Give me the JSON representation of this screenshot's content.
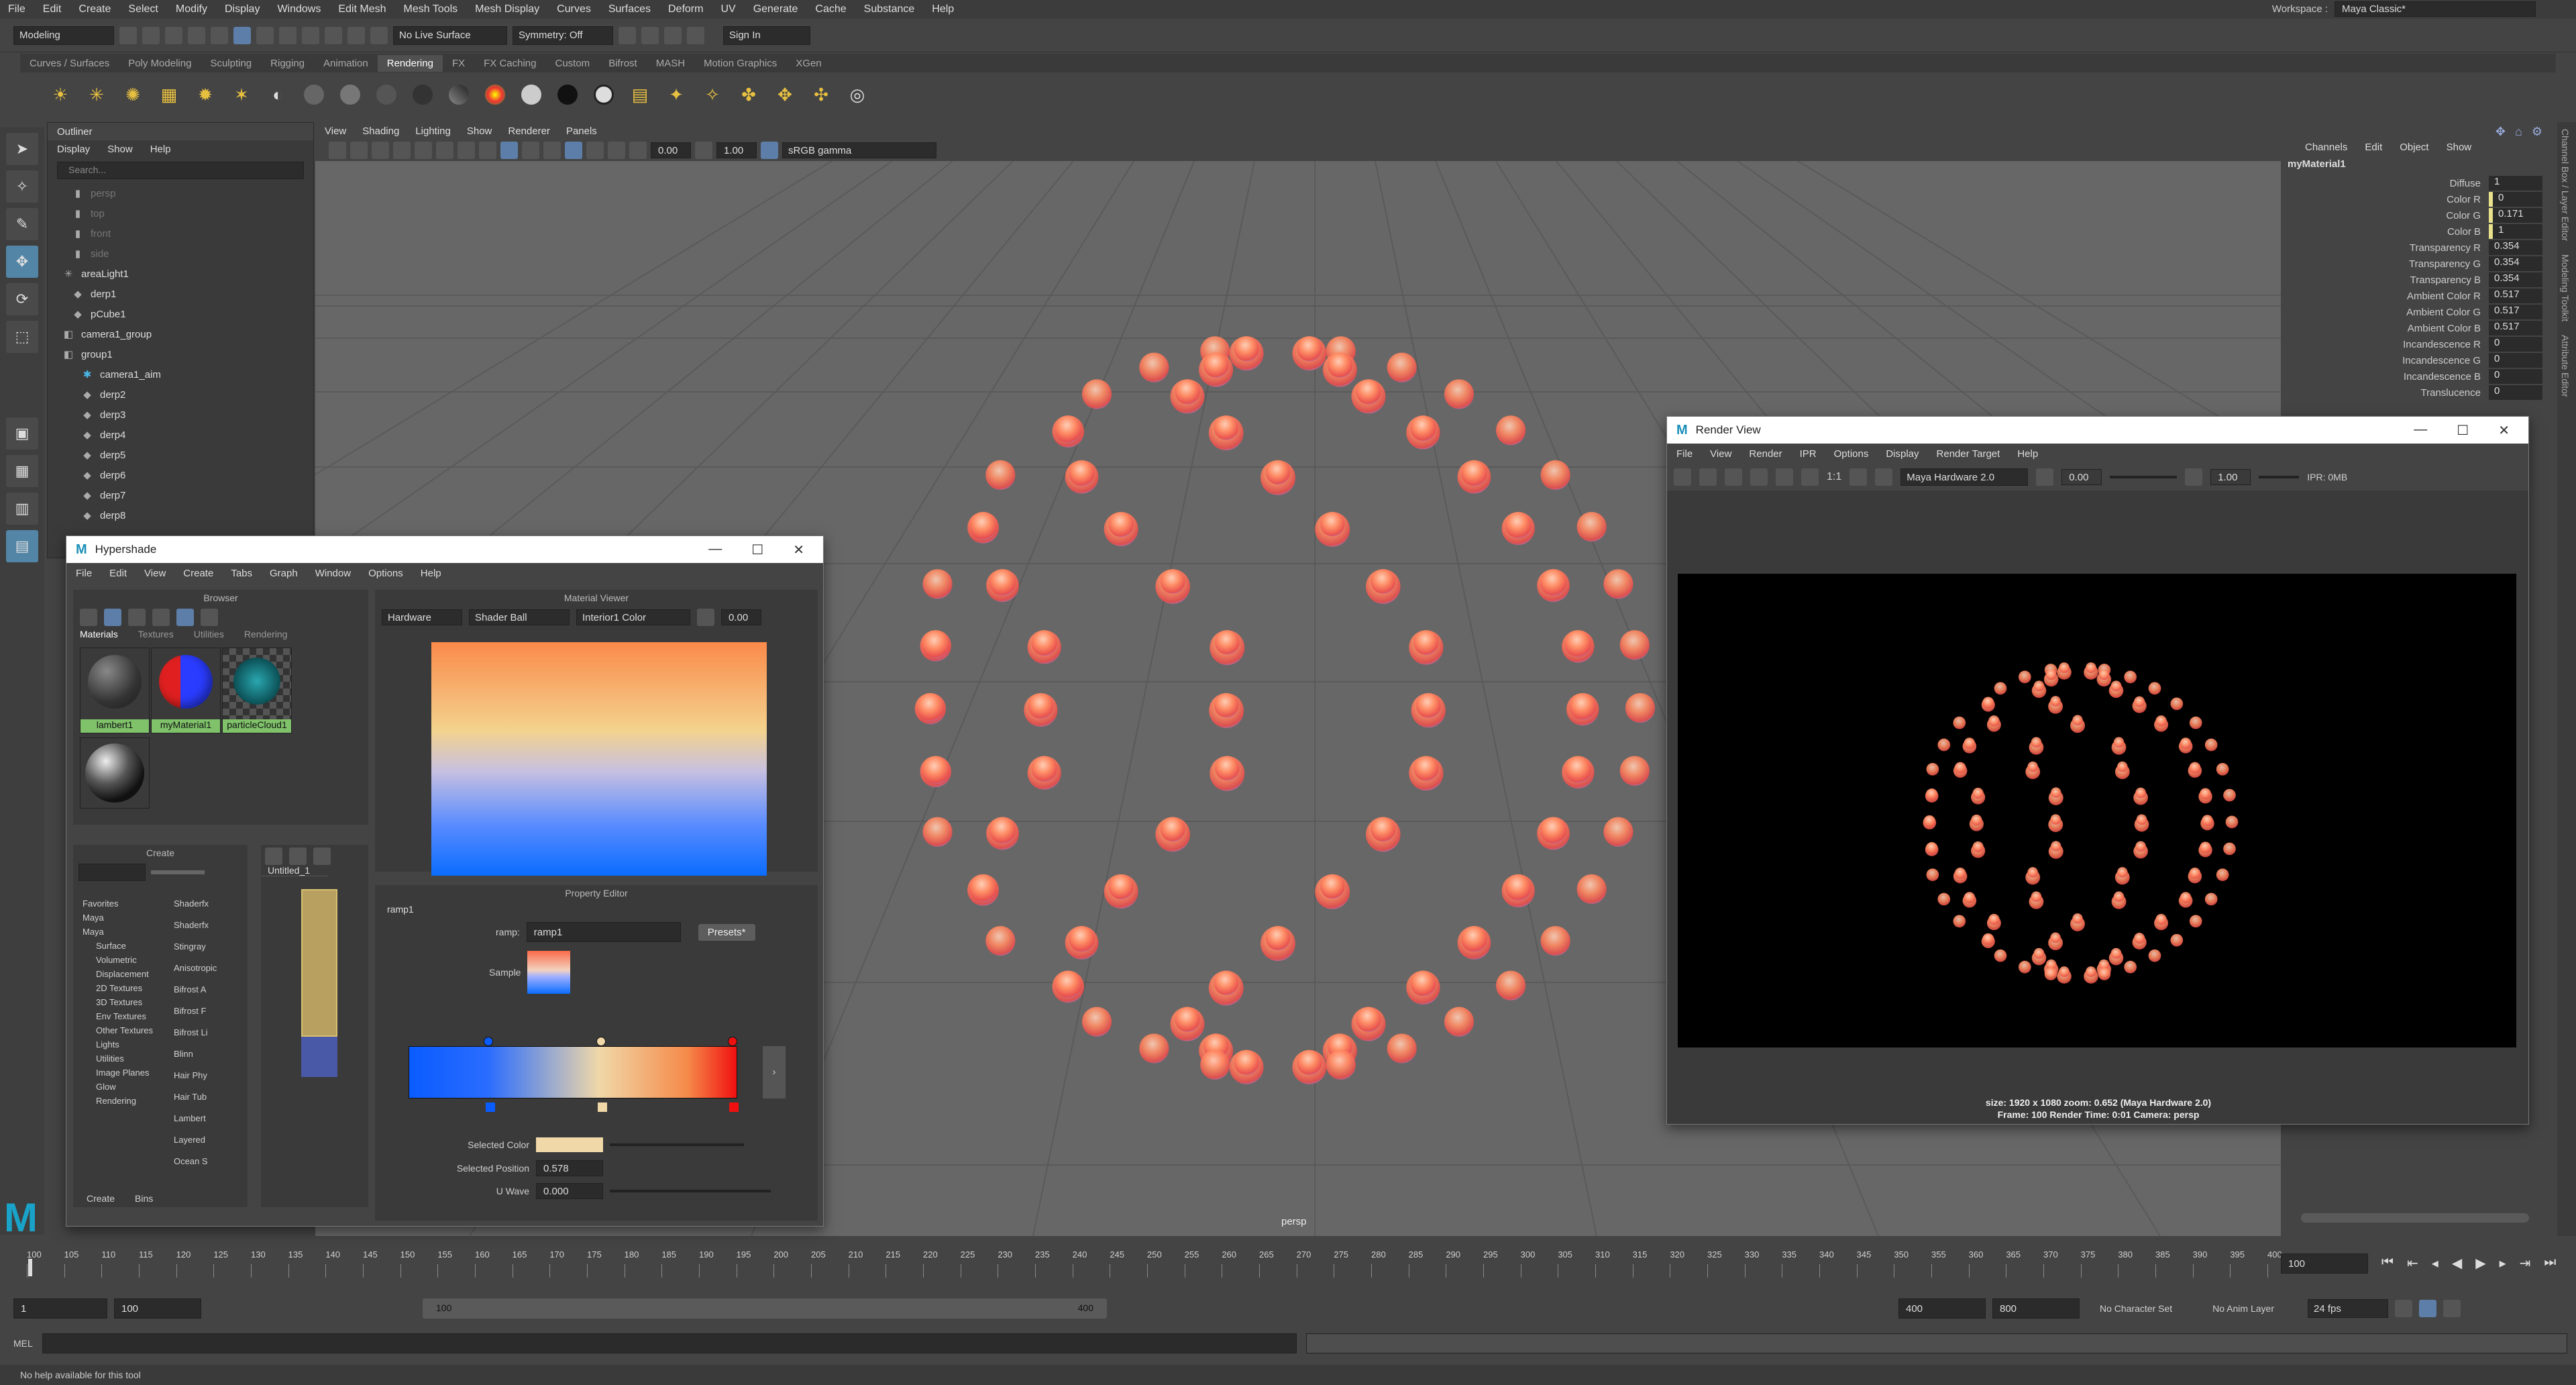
{
  "menubar": {
    "items": [
      "File",
      "Edit",
      "Create",
      "Select",
      "Modify",
      "Display",
      "Windows",
      "Edit Mesh",
      "Mesh Tools",
      "Mesh Display",
      "Curves",
      "Surfaces",
      "Deform",
      "UV",
      "Generate",
      "Cache",
      "Substance",
      "Help"
    ]
  },
  "workspace": {
    "label": "Workspace :",
    "value": "Maya Classic*"
  },
  "status": {
    "mode": "Modeling",
    "live_surface": "No Live Surface",
    "symmetry": "Symmetry: Off",
    "signin": "Sign In"
  },
  "shelf_tabs": [
    "Curves / Surfaces",
    "Poly Modeling",
    "Sculpting",
    "Rigging",
    "Animation",
    "Rendering",
    "FX",
    "FX Caching",
    "Custom",
    "Bifrost",
    "MASH",
    "Motion Graphics",
    "XGen"
  ],
  "shelf_active": "Rendering",
  "outliner": {
    "title": "Outliner",
    "menu": [
      "Display",
      "Show",
      "Help"
    ],
    "search_placeholder": "Search...",
    "items": [
      {
        "label": "persp",
        "dim": true,
        "indent": 1,
        "icon": "camera-icon"
      },
      {
        "label": "top",
        "dim": true,
        "indent": 1,
        "icon": "camera-icon"
      },
      {
        "label": "front",
        "dim": true,
        "indent": 1,
        "icon": "camera-icon"
      },
      {
        "label": "side",
        "dim": true,
        "indent": 1,
        "icon": "camera-icon"
      },
      {
        "label": "areaLight1",
        "dim": false,
        "indent": 0,
        "icon": "light-icon"
      },
      {
        "label": "derp1",
        "dim": false,
        "indent": 1,
        "icon": "mesh-icon"
      },
      {
        "label": "pCube1",
        "dim": false,
        "indent": 1,
        "icon": "mesh-icon"
      },
      {
        "label": "camera1_group",
        "dim": false,
        "indent": 0,
        "icon": "group-icon"
      },
      {
        "label": "group1",
        "dim": false,
        "indent": 0,
        "icon": "group-icon"
      },
      {
        "label": "camera1_aim",
        "dim": false,
        "indent": 2,
        "icon": "aim-icon"
      },
      {
        "label": "derp2",
        "dim": false,
        "indent": 2,
        "icon": "mesh-icon"
      },
      {
        "label": "derp3",
        "dim": false,
        "indent": 2,
        "icon": "mesh-icon"
      },
      {
        "label": "derp4",
        "dim": false,
        "indent": 2,
        "icon": "mesh-icon"
      },
      {
        "label": "derp5",
        "dim": false,
        "indent": 2,
        "icon": "mesh-icon"
      },
      {
        "label": "derp6",
        "dim": false,
        "indent": 2,
        "icon": "mesh-icon"
      },
      {
        "label": "derp7",
        "dim": false,
        "indent": 2,
        "icon": "mesh-icon"
      },
      {
        "label": "derp8",
        "dim": false,
        "indent": 2,
        "icon": "mesh-icon"
      }
    ]
  },
  "viewport": {
    "menu": [
      "View",
      "Shading",
      "Lighting",
      "Show",
      "Renderer",
      "Panels"
    ],
    "field1": "0.00",
    "field2": "1.00",
    "colorspace": "sRGB gamma",
    "camera_label": "persp"
  },
  "channelbox": {
    "menu": [
      "Channels",
      "Edit",
      "Object",
      "Show"
    ],
    "object": "myMaterial1",
    "rows": [
      {
        "label": "Diffuse",
        "value": "1",
        "swatch": false
      },
      {
        "label": "Color R",
        "value": "0",
        "swatch": true
      },
      {
        "label": "Color G",
        "value": "0.171",
        "swatch": true
      },
      {
        "label": "Color B",
        "value": "1",
        "swatch": true
      },
      {
        "label": "Transparency R",
        "value": "0.354",
        "swatch": false
      },
      {
        "label": "Transparency G",
        "value": "0.354",
        "swatch": false
      },
      {
        "label": "Transparency B",
        "value": "0.354",
        "swatch": false
      },
      {
        "label": "Ambient Color R",
        "value": "0.517",
        "swatch": false
      },
      {
        "label": "Ambient Color G",
        "value": "0.517",
        "swatch": false
      },
      {
        "label": "Ambient Color B",
        "value": "0.517",
        "swatch": false
      },
      {
        "label": "Incandescence R",
        "value": "0",
        "swatch": false
      },
      {
        "label": "Incandescence G",
        "value": "0",
        "swatch": false
      },
      {
        "label": "Incandescence B",
        "value": "0",
        "swatch": false
      },
      {
        "label": "Translucence",
        "value": "0",
        "swatch": false
      }
    ],
    "side_tabs": [
      "Channel Box / Layer Editor",
      "Modeling Toolkit",
      "Attribute Editor"
    ]
  },
  "hypershade": {
    "title": "Hypershade",
    "menu": [
      "File",
      "Edit",
      "View",
      "Create",
      "Tabs",
      "Graph",
      "Window",
      "Options",
      "Help"
    ],
    "browser": {
      "title": "Browser",
      "tabs": [
        "Materials",
        "Textures",
        "Utilities",
        "Rendering"
      ],
      "tiles": [
        {
          "label": "lambert1"
        },
        {
          "label": "myMaterial1"
        },
        {
          "label": "particleCloud1"
        }
      ]
    },
    "material_viewer": {
      "title": "Material Viewer",
      "renderer": "Hardware",
      "shape": "Shader Ball",
      "env": "Interior1 Color",
      "value": "0.00"
    },
    "create": {
      "title": "Create",
      "categories": [
        "Favorites",
        "Maya",
        "Maya",
        "Surface",
        "Volumetric",
        "Displacement",
        "2D Textures",
        "3D Textures",
        "Env Textures",
        "Other Textures",
        "Lights",
        "Utilities",
        "Image Planes",
        "Glow",
        "Rendering"
      ],
      "nodes": [
        "Shaderfx",
        "Shaderfx",
        "Stingray",
        "Anisotropic",
        "Bifrost A",
        "Bifrost F",
        "Bifrost Li",
        "Blinn",
        "Hair Phy",
        "Hair Tub",
        "Lambert",
        "Layered",
        "Ocean S"
      ],
      "tabs": [
        "Create",
        "Bins"
      ]
    },
    "graph": {
      "tab": "Untitled_1"
    },
    "property_editor": {
      "title": "Property Editor",
      "node": "ramp1",
      "ramp_label": "ramp:",
      "ramp_value": "ramp1",
      "presets": "Presets*",
      "sample_label": "Sample",
      "selected_color_label": "Selected Color",
      "selected_position_label": "Selected Position",
      "selected_position": "0.578",
      "uwave_label": "U Wave",
      "uwave": "0.000"
    }
  },
  "renderview": {
    "title": "Render View",
    "menu": [
      "File",
      "View",
      "Render",
      "IPR",
      "Options",
      "Display",
      "Render Target",
      "Help"
    ],
    "renderer": "Maya Hardware 2.0",
    "exposure": "0.00",
    "gamma": "1.00",
    "ipr": "IPR: 0MB",
    "ratio": "1:1",
    "info_line1": "size: 1920 x 1080 zoom: 0.652     (Maya Hardware 2.0)",
    "info_line2": "Frame: 100     Render Time: 0:01     Camera: persp"
  },
  "timeline": {
    "ticks": [
      "100",
      "105",
      "110",
      "115",
      "120",
      "125",
      "130",
      "135",
      "140",
      "145",
      "150",
      "155",
      "160",
      "165",
      "170",
      "175",
      "180",
      "185",
      "190",
      "195",
      "200",
      "205",
      "210",
      "215",
      "220",
      "225",
      "230",
      "235",
      "240",
      "245",
      "250",
      "255",
      "260",
      "265",
      "270",
      "275",
      "280",
      "285",
      "290",
      "295",
      "300",
      "305",
      "310",
      "315",
      "320",
      "325",
      "330",
      "335",
      "340",
      "345",
      "350",
      "355",
      "360",
      "365",
      "370",
      "375",
      "380",
      "385",
      "390",
      "395",
      "400"
    ],
    "current": "100"
  },
  "range": {
    "start": "1",
    "start2": "100",
    "inner_start": "100",
    "inner_end": "400",
    "end1": "400",
    "end2": "800",
    "charset": "No Character Set",
    "anim": "No Anim Layer",
    "fps": "24 fps"
  },
  "cmd": {
    "lang": "MEL"
  },
  "help": "No help available for this tool",
  "colors": {
    "accent": "#5285a6",
    "sphere": "#ff8a62",
    "material_green": "#7fc26a"
  }
}
